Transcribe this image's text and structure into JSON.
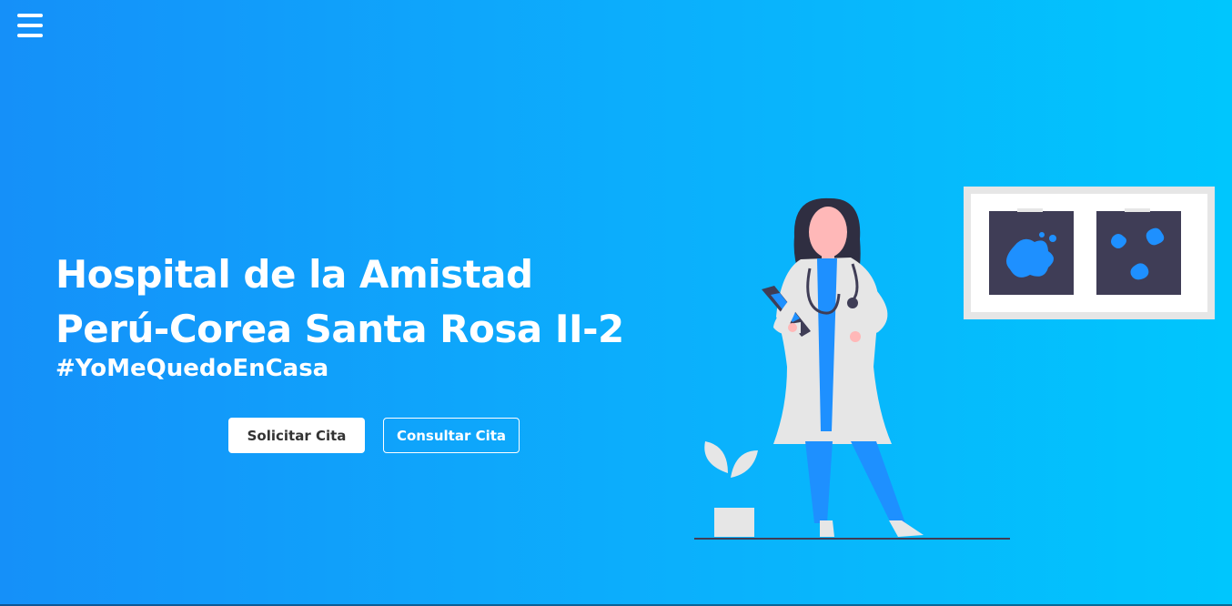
{
  "nav": {
    "menu_icon": "hamburger-menu-icon"
  },
  "hero": {
    "title_line1": "Hospital de la Amistad",
    "title_line2": "Perú-Corea Santa Rosa II-2",
    "hashtag": "#YoMeQuedoEnCasa"
  },
  "buttons": {
    "solicitar": "Solicitar Cita",
    "consultar": "Consultar Cita"
  },
  "colors": {
    "gradient_start": "#1590f9",
    "gradient_end": "#00c6fd",
    "accent": "#1e90ff",
    "dark_panel": "#3f3d56"
  },
  "illustration": {
    "icon": "doctor-illustration"
  }
}
